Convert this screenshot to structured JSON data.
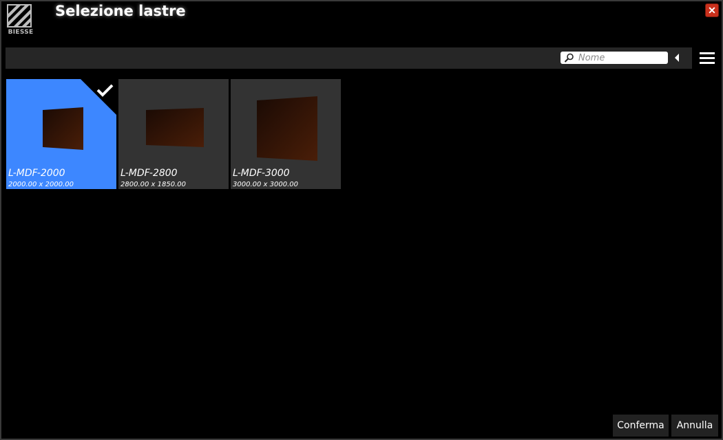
{
  "window": {
    "title": "Selezione lastre"
  },
  "logo": {
    "text": "BIESSE"
  },
  "search": {
    "placeholder": "Nome",
    "value": ""
  },
  "slabs": [
    {
      "name": "L-MDF-2000",
      "dims": "2000.00 x 2000.00",
      "selected": true
    },
    {
      "name": "L-MDF-2800",
      "dims": "2800.00 x 1850.00",
      "selected": false
    },
    {
      "name": "L-MDF-3000",
      "dims": "3000.00 x 3000.00",
      "selected": false
    }
  ],
  "actions": {
    "confirm": "Conferma",
    "cancel": "Annulla",
    "close_glyph": "✕"
  },
  "colors": {
    "selected": "#3d87ff",
    "tile": "#333333",
    "toolbar": "#262626",
    "close": "#c9301c",
    "slab_dark": "#1a0a04",
    "slab_light": "#4a1e08"
  },
  "icons": [
    "biesse-logo-icon",
    "close-icon",
    "search-icon",
    "collapse-arrow-icon",
    "hamburger-menu-icon",
    "checkmark-icon"
  ]
}
